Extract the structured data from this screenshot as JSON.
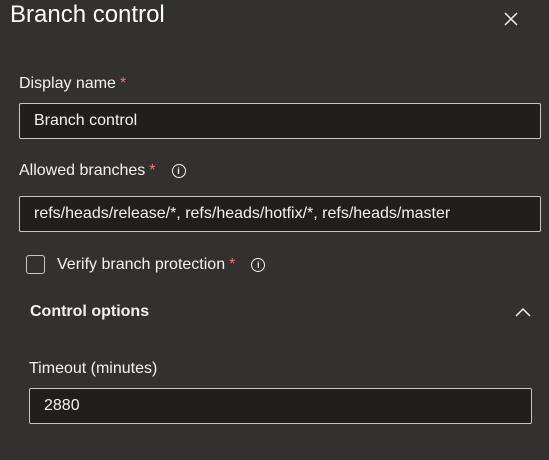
{
  "panel": {
    "title": "Branch control",
    "close_icon": "close-icon"
  },
  "fields": {
    "display_name": {
      "label": "Display name",
      "required_mark": "*",
      "value": "Branch control"
    },
    "allowed_branches": {
      "label": "Allowed branches",
      "required_mark": "*",
      "info": "i",
      "value": "refs/heads/release/*, refs/heads/hotfix/*, refs/heads/master"
    },
    "verify_branch_protection": {
      "label": "Verify branch protection",
      "required_mark": "*",
      "info": "i",
      "checked": false
    }
  },
  "control_options": {
    "title": "Control options",
    "expanded": true,
    "timeout": {
      "label": "Timeout (minutes)",
      "value": "2880"
    }
  },
  "colors": {
    "background": "#323130",
    "input_bg": "#201f1e",
    "required": "#f1707b",
    "border": "#c8c6c4"
  }
}
